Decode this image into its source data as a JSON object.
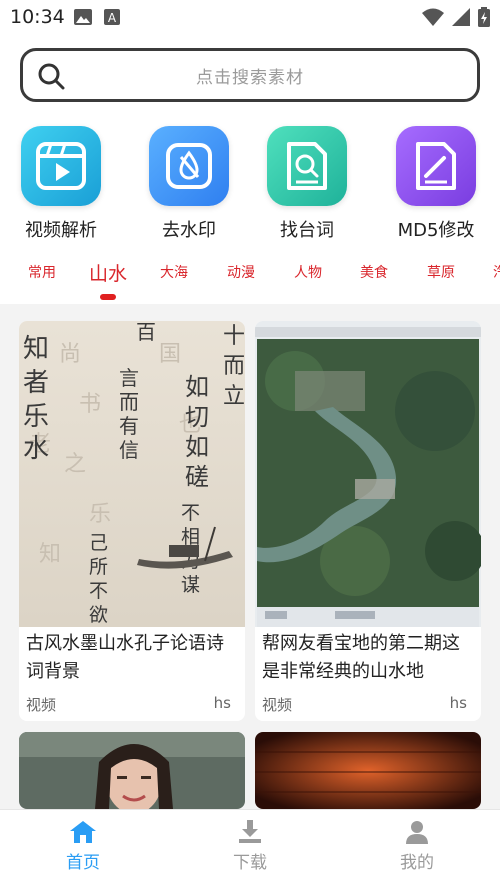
{
  "status_bar": {
    "time": "10:34",
    "left_icons": [
      "image-icon",
      "a-box-icon"
    ],
    "right_icons": [
      "wifi-icon",
      "signal-icon",
      "battery-icon"
    ]
  },
  "search": {
    "placeholder": "点击搜索素材"
  },
  "quick_actions": [
    {
      "label": "视频解析",
      "icon": "video-parse-icon",
      "color": "#25b8e0"
    },
    {
      "label": "去水印",
      "icon": "remove-watermark-icon",
      "color": "#3a8ff0"
    },
    {
      "label": "找台词",
      "icon": "find-lines-icon",
      "color": "#27c3a8"
    },
    {
      "label": "MD5修改",
      "icon": "md5-edit-icon",
      "color": "#8a4fe6"
    }
  ],
  "categories": {
    "items": [
      "常用",
      "山水",
      "大海",
      "动漫",
      "人物",
      "美食",
      "草原",
      "汽"
    ],
    "selected": "山水",
    "accent": "#d9262c"
  },
  "cards": [
    {
      "title": "古风水墨山水孔子论语诗词背景",
      "type": "视频",
      "author": "hs",
      "image": "ink-calligraphy-landscape"
    },
    {
      "title": "帮网友看宝地的第二期这是非常经典的山水地",
      "type": "视频",
      "author": "hs",
      "image": "satellite-river-map"
    },
    {
      "title": "",
      "type": "",
      "author": "",
      "image": "woman-portrait"
    },
    {
      "title": "",
      "type": "",
      "author": "",
      "image": "wooden-stage-orange"
    }
  ],
  "bottom_nav": {
    "items": [
      {
        "label": "首页",
        "icon": "home-icon",
        "active": true
      },
      {
        "label": "下载",
        "icon": "download-icon",
        "active": false
      },
      {
        "label": "我的",
        "icon": "profile-icon",
        "active": false
      }
    ],
    "active_color": "#2a9df4",
    "inactive_color": "#9a9a9a"
  }
}
